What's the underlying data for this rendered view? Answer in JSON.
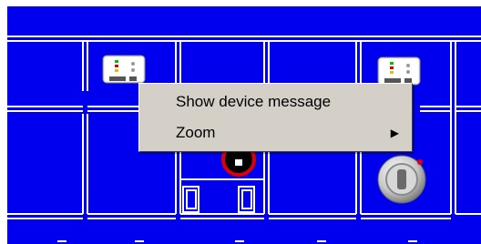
{
  "context_menu": {
    "items": [
      {
        "label": "Show device message",
        "has_submenu": false
      },
      {
        "label": "Zoom",
        "has_submenu": true
      }
    ]
  },
  "icons": {
    "device": "smoke-detector-icon",
    "alarm": "alarm-indicator-icon",
    "info": "info-button-icon"
  },
  "colors": {
    "floorplan_bg": "#0000ee",
    "walls": "#ffffff",
    "menu_bg": "#d4d0c8",
    "alarm_ring": "#e00000"
  }
}
